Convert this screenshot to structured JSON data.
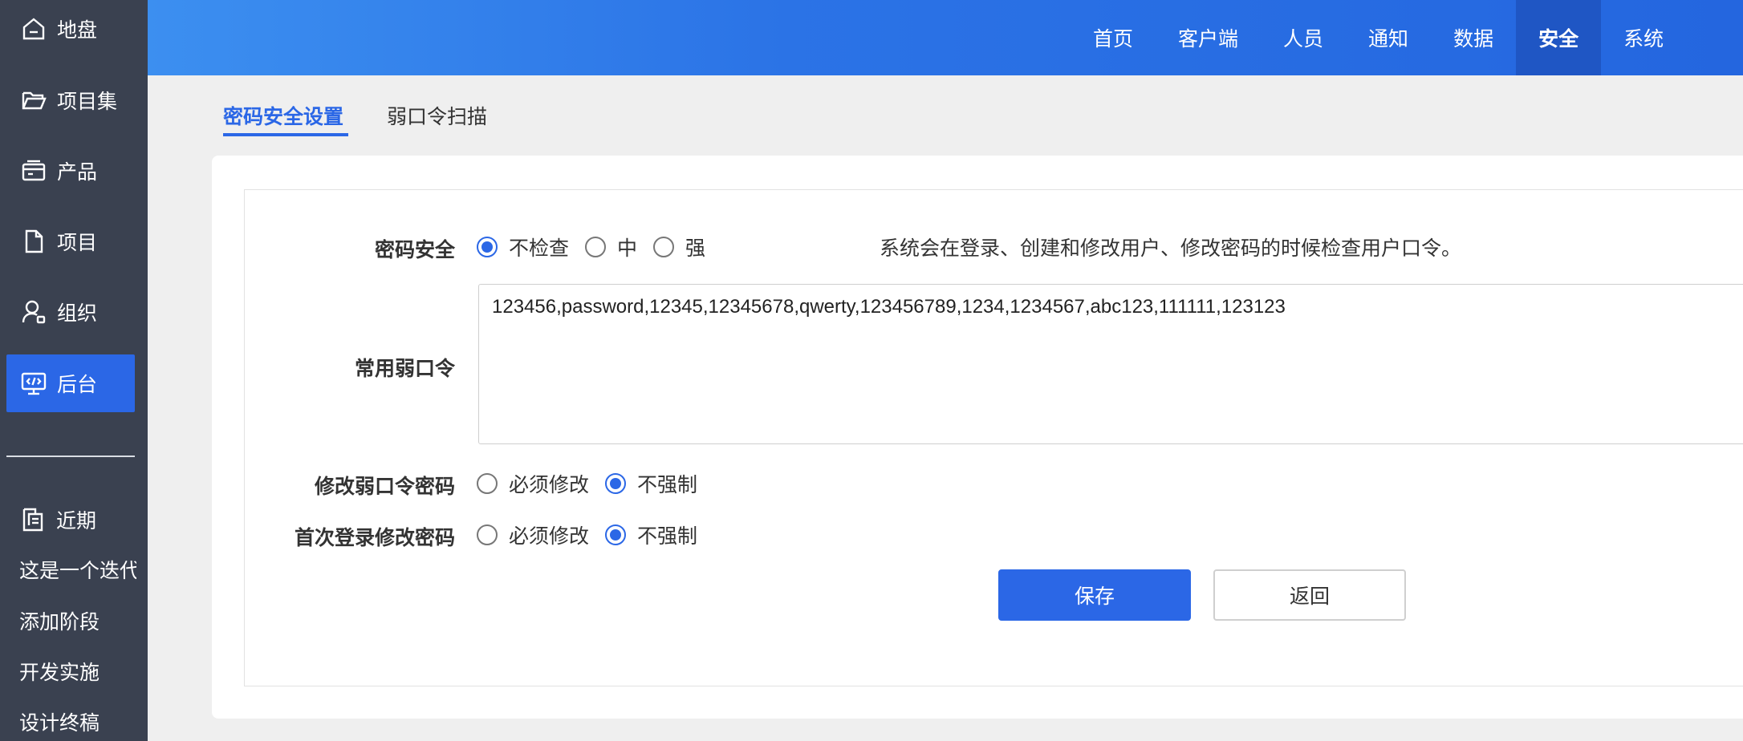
{
  "sidebar": {
    "items": [
      {
        "label": "地盘",
        "icon": "home-icon"
      },
      {
        "label": "项目集",
        "icon": "folder-open-icon"
      },
      {
        "label": "产品",
        "icon": "product-icon"
      },
      {
        "label": "项目",
        "icon": "document-icon"
      },
      {
        "label": "组织",
        "icon": "user-icon"
      },
      {
        "label": "后台",
        "icon": "monitor-code-icon",
        "active": true
      }
    ],
    "recent": {
      "label": "近期",
      "icon": "recent-icon",
      "items": [
        "这是一个迭代",
        "添加阶段",
        "开发实施",
        "设计终稿"
      ]
    }
  },
  "topnav": {
    "items": [
      "首页",
      "客户端",
      "人员",
      "通知",
      "数据",
      "安全",
      "系统"
    ],
    "active": "安全"
  },
  "subtabs": {
    "password_settings": "密码安全设置",
    "weak_scan": "弱口令扫描"
  },
  "form": {
    "password_security": {
      "label": "密码安全",
      "options": [
        "不检查",
        "中",
        "强"
      ],
      "selected": "不检查",
      "hint": "系统会在登录、创建和修改用户、修改密码的时候检查用户口令。"
    },
    "common_weak": {
      "label": "常用弱口令",
      "value": "123456,password,12345,12345678,qwerty,123456789,1234,1234567,abc123,111111,123123"
    },
    "change_weak": {
      "label": "修改弱口令密码",
      "options": [
        "必须修改",
        "不强制"
      ],
      "selected": "不强制"
    },
    "first_login": {
      "label": "首次登录修改密码",
      "options": [
        "必须修改",
        "不强制"
      ],
      "selected": "不强制"
    },
    "save_label": "保存",
    "back_label": "返回"
  },
  "colors": {
    "accent": "#2b67e6",
    "sidebar_bg": "#3a4150",
    "topbar_active": "#1f56c4"
  }
}
